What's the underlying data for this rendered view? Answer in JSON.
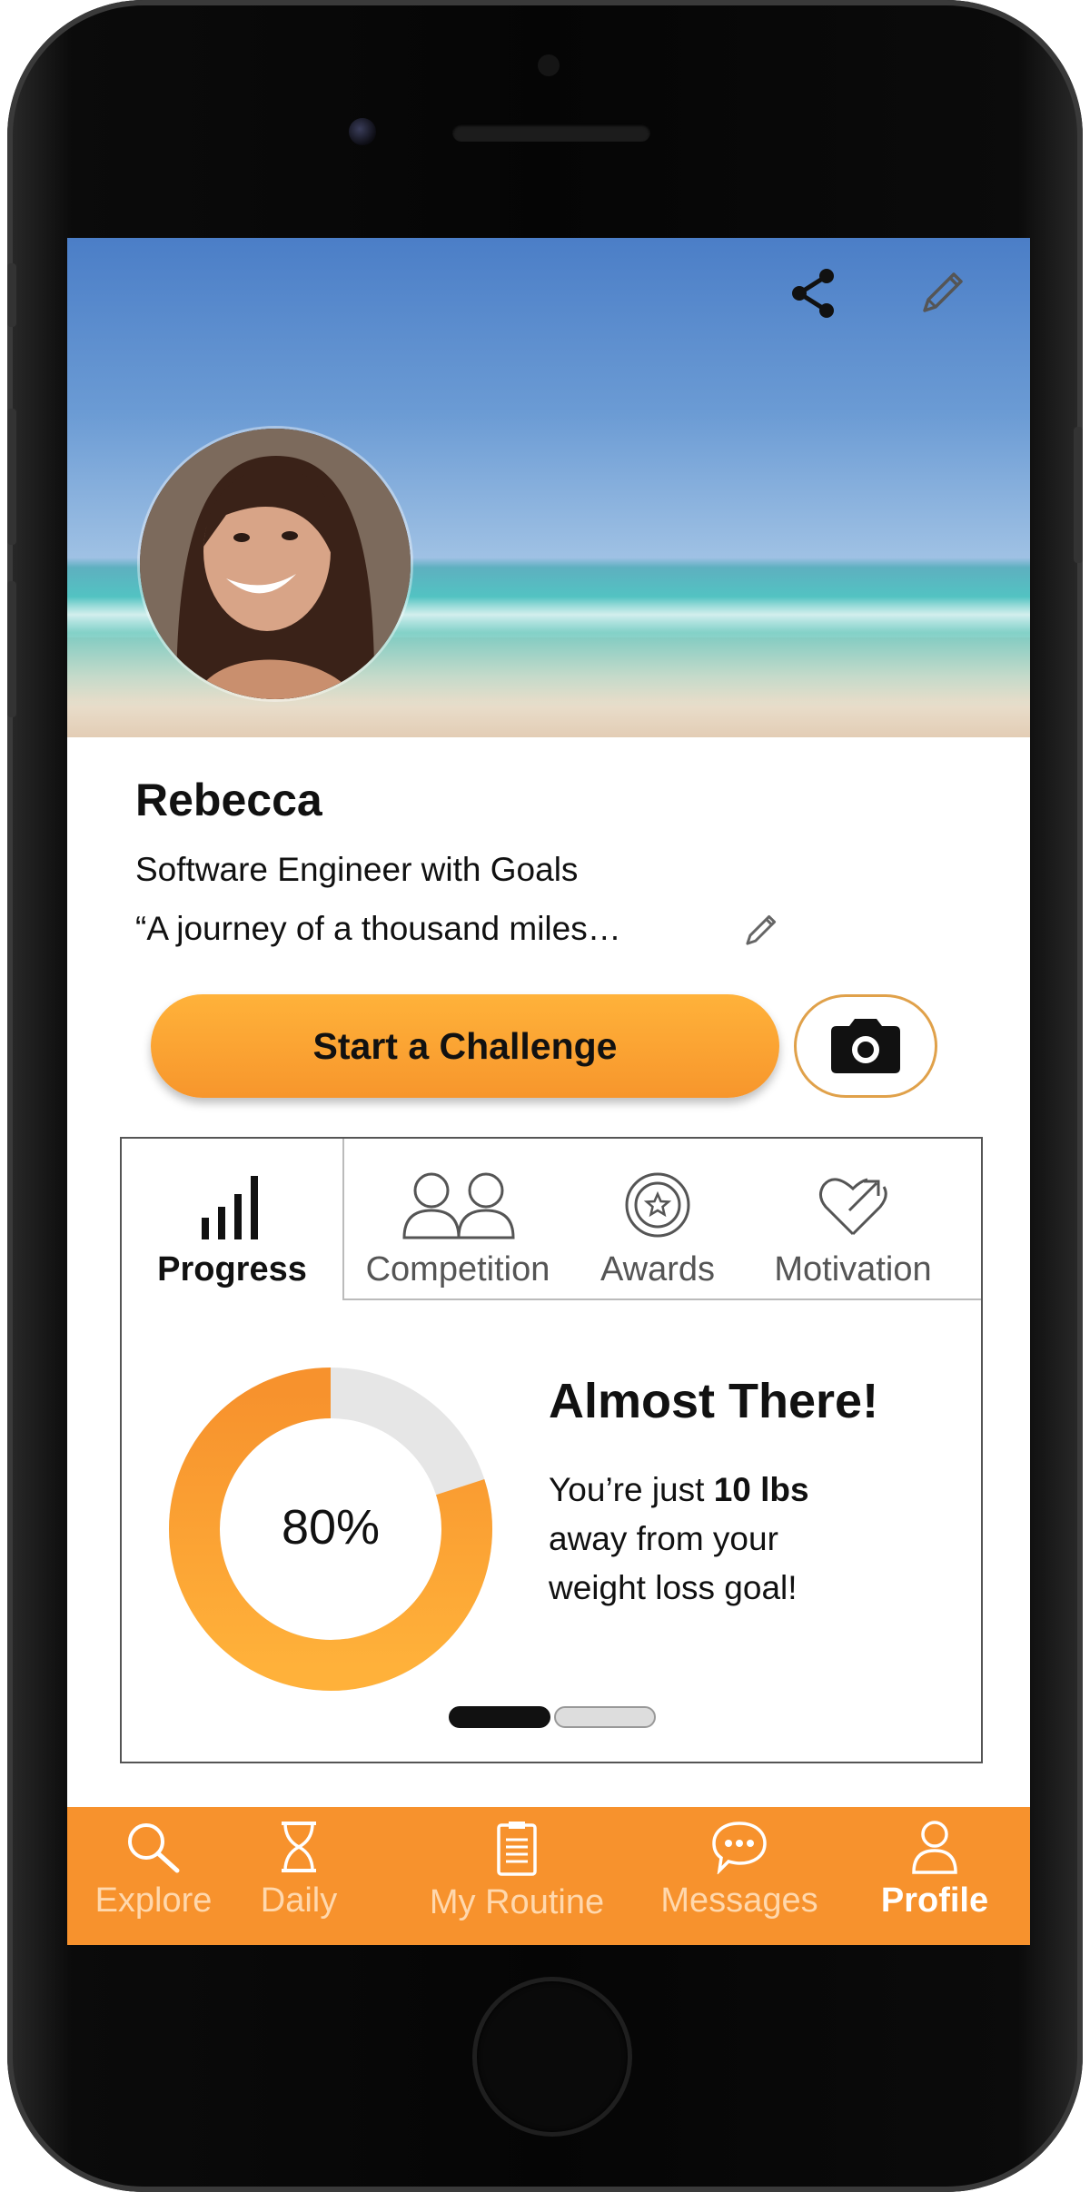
{
  "profile": {
    "name": "Rebecca",
    "title": "Software Engineer with Goals",
    "quote": "“A journey of a thousand miles…"
  },
  "actions": {
    "start_challenge": "Start a Challenge"
  },
  "tabs": [
    {
      "label": "Progress",
      "icon": "bar-chart-icon",
      "active": true
    },
    {
      "label": "Competition",
      "icon": "people-icon",
      "active": false
    },
    {
      "label": "Awards",
      "icon": "award-icon",
      "active": false
    },
    {
      "label": "Motivation",
      "icon": "heart-arrow-icon",
      "active": false
    }
  ],
  "progress": {
    "percent": 80,
    "percent_label": "80%",
    "heading": "Almost There!",
    "message_prefix": "You’re just ",
    "message_bold": "10 lbs",
    "message_line2": "away from your",
    "message_line3": "weight loss goal!",
    "page_index": 0,
    "page_count": 2
  },
  "nav": [
    {
      "label": "Explore",
      "icon": "search-icon",
      "active": false
    },
    {
      "label": "Daily",
      "icon": "hourglass-icon",
      "active": false
    },
    {
      "label": "My Routine",
      "icon": "clipboard-icon",
      "active": false
    },
    {
      "label": "Messages",
      "icon": "chat-bubble-icon",
      "active": false
    },
    {
      "label": "Profile",
      "icon": "person-icon",
      "active": true
    }
  ],
  "colors": {
    "accent": "#f7922d",
    "donut_filled": "#fba32c",
    "donut_empty": "#e6e6e6"
  }
}
